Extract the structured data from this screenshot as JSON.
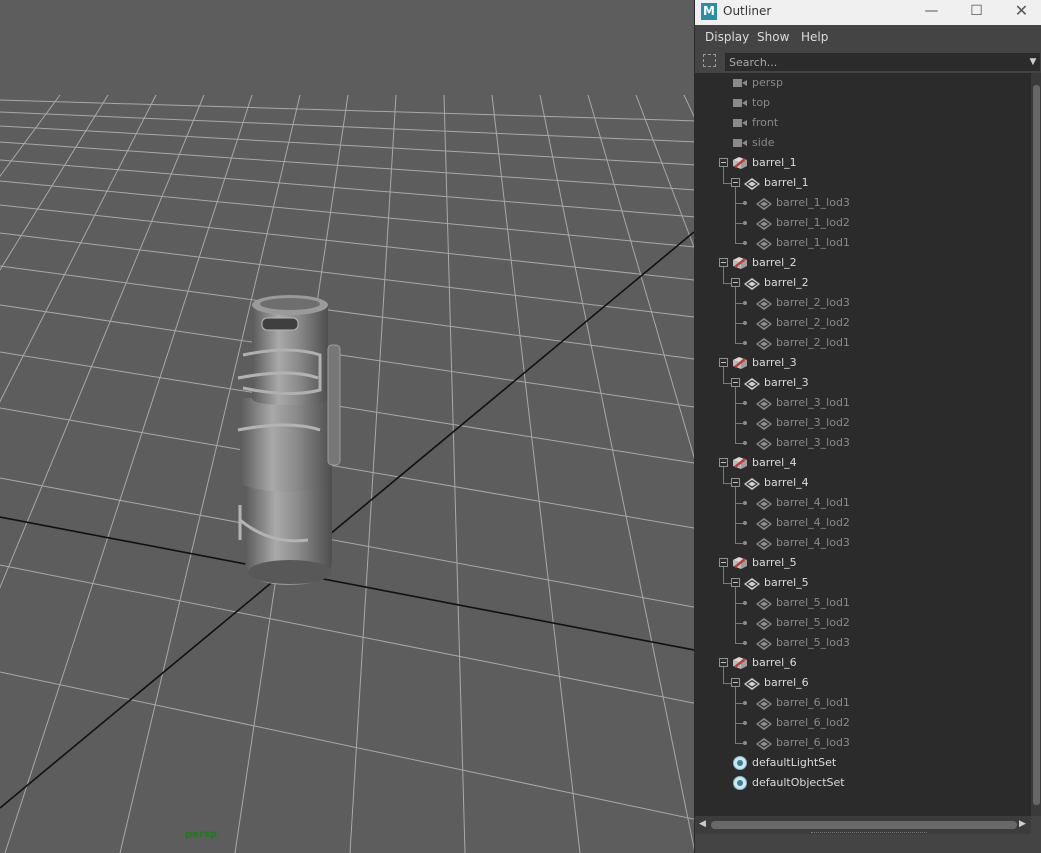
{
  "viewport": {
    "camera_label": "persp"
  },
  "outliner": {
    "app_icon_letter": "M",
    "title": "Outliner",
    "window_buttons": {
      "minimize": "—",
      "maximize": "☐",
      "close": "✕"
    },
    "menu": [
      "Display",
      "Show",
      "Help"
    ],
    "search": {
      "placeholder": "Search...",
      "value": ""
    },
    "colors": {
      "panel": "#444444",
      "tree_bg": "#2b2b2b",
      "group_icon_red": "#c23b3b",
      "set_icon_teal": "#3a7f94",
      "camera_label_green": "#1f7a1f"
    },
    "cameras": [
      "persp",
      "top",
      "front",
      "side"
    ],
    "groups": [
      {
        "name": "barrel_1",
        "mesh": "barrel_1",
        "lods": [
          "barrel_1_lod3",
          "barrel_1_lod2",
          "barrel_1_lod1"
        ]
      },
      {
        "name": "barrel_2",
        "mesh": "barrel_2",
        "lods": [
          "barrel_2_lod3",
          "barrel_2_lod2",
          "barrel_2_lod1"
        ]
      },
      {
        "name": "barrel_3",
        "mesh": "barrel_3",
        "lods": [
          "barrel_3_lod1",
          "barrel_3_lod2",
          "barrel_3_lod3"
        ]
      },
      {
        "name": "barrel_4",
        "mesh": "barrel_4",
        "lods": [
          "barrel_4_lod1",
          "barrel_4_lod2",
          "barrel_4_lod3"
        ]
      },
      {
        "name": "barrel_5",
        "mesh": "barrel_5",
        "lods": [
          "barrel_5_lod1",
          "barrel_5_lod2",
          "barrel_5_lod3"
        ]
      },
      {
        "name": "barrel_6",
        "mesh": "barrel_6",
        "lods": [
          "barrel_6_lod1",
          "barrel_6_lod2",
          "barrel_6_lod3"
        ]
      }
    ],
    "sets": [
      "defaultLightSet",
      "defaultObjectSet"
    ]
  }
}
